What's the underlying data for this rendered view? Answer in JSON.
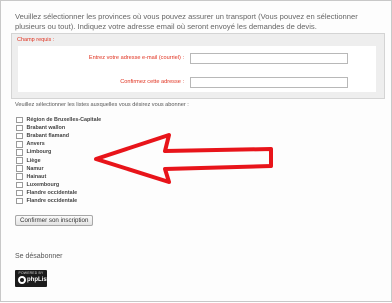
{
  "intro_text": "Veuillez sélectionner les provinces où vous pouvez assurer un transport (Vous pouvez en sélectionner plusieurs ou tout). Indiquez votre adresse email où seront envoyé les demandes de devis.",
  "required_label": "Champ requis :",
  "fields": {
    "email_label": "Entrez votre adresse e-mail (courriel) :",
    "email_value": "",
    "confirm_label": "Confirmez cette adresse :",
    "confirm_value": ""
  },
  "list_intro": "Veuillez sélectionner les listes auxquelles vous désirez vous abonner :",
  "provinces": [
    {
      "label": "Région de Bruxelles-Capitale",
      "checked": false
    },
    {
      "label": "Brabant wallon",
      "checked": false
    },
    {
      "label": "Brabant flamand",
      "checked": false
    },
    {
      "label": "Anvers",
      "checked": false
    },
    {
      "label": "Limbourg",
      "checked": false
    },
    {
      "label": "Liège",
      "checked": false
    },
    {
      "label": "Namur",
      "checked": false
    },
    {
      "label": "Hainaut",
      "checked": false
    },
    {
      "label": "Luxembourg",
      "checked": false
    },
    {
      "label": "Flandre occidentale",
      "checked": false
    },
    {
      "label": "Flandre occidentale",
      "checked": false
    }
  ],
  "confirm_button": "Confirmer son inscription",
  "unsubscribe_link": "Se désabonner",
  "badge": {
    "powered_by": "POWERED BY",
    "brand": "phpList",
    "icon": "phplist-logo-icon"
  },
  "annotation": {
    "icon": "left-arrow-icon",
    "color": "#e8141a"
  },
  "colors": {
    "required_red": "#e0301e",
    "panel_gray": "#eeeeee"
  }
}
